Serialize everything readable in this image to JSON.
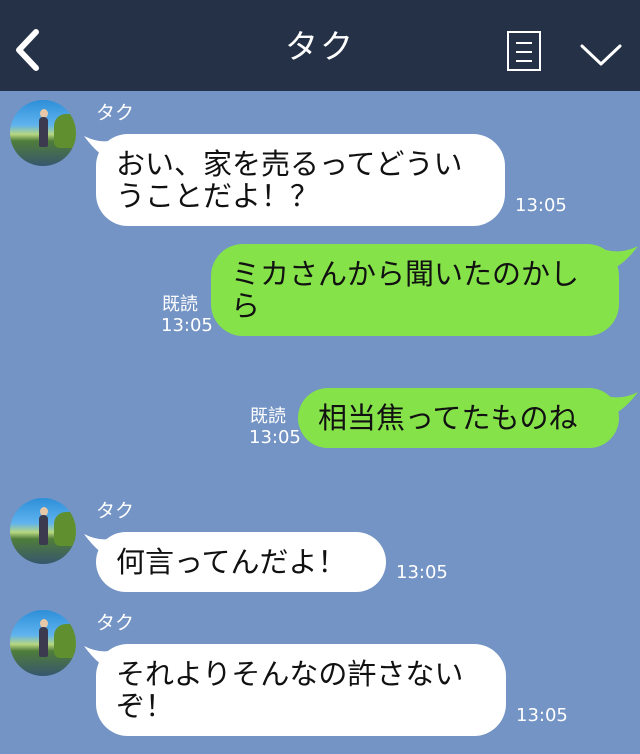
{
  "header": {
    "title": "タク",
    "back_icon": "chevron-left-icon",
    "menu_icon": "list-icon",
    "collapse_icon": "chevron-down-icon",
    "background": "#253147"
  },
  "colors": {
    "chat_background": "#7394c4",
    "incoming_bubble": "#ffffff",
    "outgoing_bubble": "#85e249"
  },
  "messages": [
    {
      "direction": "incoming",
      "sender": "タク",
      "text": "おい、家を売るってどういうことだよ！？",
      "time": "13:05"
    },
    {
      "direction": "outgoing",
      "text": "ミカさんから聞いたのかしら",
      "time": "13:05",
      "read": "既読"
    },
    {
      "direction": "outgoing",
      "text": "相当焦ってたものね",
      "time": "13:05",
      "read": "既読"
    },
    {
      "direction": "incoming",
      "sender": "タク",
      "text": "何言ってんだよ！",
      "time": "13:05"
    },
    {
      "direction": "incoming",
      "sender": "タク",
      "text": "それよりそんなの許さないぞ！",
      "time": "13:05"
    }
  ]
}
